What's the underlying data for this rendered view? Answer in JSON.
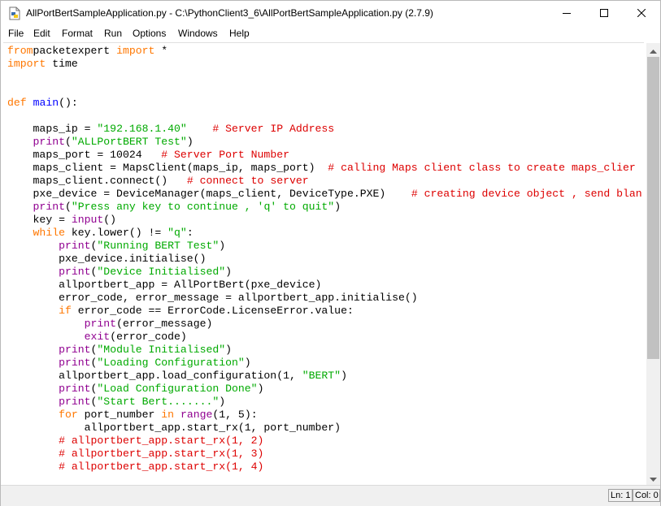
{
  "window": {
    "title": "AllPortBertSampleApplication.py - C:\\PythonClient3_6\\AllPortBertSampleApplication.py (2.7.9)",
    "icons": {
      "app": "python-file-icon",
      "minimize": "minimize-icon",
      "maximize": "maximize-icon",
      "close": "close-icon"
    }
  },
  "menu": {
    "items": [
      "File",
      "Edit",
      "Format",
      "Run",
      "Options",
      "Windows",
      "Help"
    ]
  },
  "editor": {
    "lines": [
      [
        [
          "kw",
          "from"
        ],
        [
          "",
          "packetexpert "
        ],
        [
          "kw",
          "import"
        ],
        [
          "",
          " *"
        ]
      ],
      [
        [
          "kw",
          "import"
        ],
        [
          "",
          " time"
        ]
      ],
      [],
      [],
      [
        [
          "kw",
          "def"
        ],
        [
          "",
          " "
        ],
        [
          "def",
          "main"
        ],
        [
          "",
          "():"
        ]
      ],
      [],
      [
        [
          "",
          "    maps_ip = "
        ],
        [
          "str",
          "\"192.168.1.40\""
        ],
        [
          "",
          "    "
        ],
        [
          "cmt",
          "# Server IP Address"
        ]
      ],
      [
        [
          "",
          "    "
        ],
        [
          "bi",
          "print"
        ],
        [
          "",
          "("
        ],
        [
          "str",
          "\"ALLPortBERT Test\""
        ],
        [
          "",
          ")"
        ]
      ],
      [
        [
          "",
          "    maps_port = 10024   "
        ],
        [
          "cmt",
          "# Server Port Number"
        ]
      ],
      [
        [
          "",
          "    maps_client = MapsClient(maps_ip, maps_port)  "
        ],
        [
          "cmt",
          "# calling Maps client class to create maps_clier"
        ]
      ],
      [
        [
          "",
          "    maps_client.connect()   "
        ],
        [
          "cmt",
          "# connect to server"
        ]
      ],
      [
        [
          "",
          "    pxe_device = DeviceManager(maps_client, DeviceType.PXE)    "
        ],
        [
          "cmt",
          "# creating device object , send blan"
        ]
      ],
      [
        [
          "",
          "    "
        ],
        [
          "bi",
          "print"
        ],
        [
          "",
          "("
        ],
        [
          "str",
          "\"Press any key to continue , 'q' to quit\""
        ],
        [
          "",
          ")"
        ]
      ],
      [
        [
          "",
          "    key = "
        ],
        [
          "bi",
          "input"
        ],
        [
          "",
          "()"
        ]
      ],
      [
        [
          "",
          "    "
        ],
        [
          "kw",
          "while"
        ],
        [
          "",
          " key.lower() != "
        ],
        [
          "str",
          "\"q\""
        ],
        [
          "",
          ":"
        ]
      ],
      [
        [
          "",
          "        "
        ],
        [
          "bi",
          "print"
        ],
        [
          "",
          "("
        ],
        [
          "str",
          "\"Running BERT Test\""
        ],
        [
          "",
          ")"
        ]
      ],
      [
        [
          "",
          "        pxe_device.initialise()"
        ]
      ],
      [
        [
          "",
          "        "
        ],
        [
          "bi",
          "print"
        ],
        [
          "",
          "("
        ],
        [
          "str",
          "\"Device Initialised\""
        ],
        [
          "",
          ")"
        ]
      ],
      [
        [
          "",
          "        allportbert_app = AllPortBert(pxe_device)"
        ]
      ],
      [
        [
          "",
          "        error_code, error_message = allportbert_app.initialise()"
        ]
      ],
      [
        [
          "",
          "        "
        ],
        [
          "kw",
          "if"
        ],
        [
          "",
          " error_code == ErrorCode.LicenseError.value:"
        ]
      ],
      [
        [
          "",
          "            "
        ],
        [
          "bi",
          "print"
        ],
        [
          "",
          "(error_message)"
        ]
      ],
      [
        [
          "",
          "            "
        ],
        [
          "bi",
          "exit"
        ],
        [
          "",
          "(error_code)"
        ]
      ],
      [
        [
          "",
          "        "
        ],
        [
          "bi",
          "print"
        ],
        [
          "",
          "("
        ],
        [
          "str",
          "\"Module Initialised\""
        ],
        [
          "",
          ")"
        ]
      ],
      [
        [
          "",
          "        "
        ],
        [
          "bi",
          "print"
        ],
        [
          "",
          "("
        ],
        [
          "str",
          "\"Loading Configuration\""
        ],
        [
          "",
          ")"
        ]
      ],
      [
        [
          "",
          "        allportbert_app.load_configuration(1, "
        ],
        [
          "str",
          "\"BERT\""
        ],
        [
          "",
          ")"
        ]
      ],
      [
        [
          "",
          "        "
        ],
        [
          "bi",
          "print"
        ],
        [
          "",
          "("
        ],
        [
          "str",
          "\"Load Configuration Done\""
        ],
        [
          "",
          ")"
        ]
      ],
      [
        [
          "",
          "        "
        ],
        [
          "bi",
          "print"
        ],
        [
          "",
          "("
        ],
        [
          "str",
          "\"Start Bert.......\""
        ],
        [
          "",
          ")"
        ]
      ],
      [
        [
          "",
          "        "
        ],
        [
          "kw",
          "for"
        ],
        [
          "",
          " port_number "
        ],
        [
          "kw",
          "in"
        ],
        [
          "",
          " "
        ],
        [
          "bi",
          "range"
        ],
        [
          "",
          "(1, 5):"
        ]
      ],
      [
        [
          "",
          "            allportbert_app.start_rx(1, port_number)"
        ]
      ],
      [
        [
          "",
          "        "
        ],
        [
          "cmt",
          "# allportbert_app.start_rx(1, 2)"
        ]
      ],
      [
        [
          "",
          "        "
        ],
        [
          "cmt",
          "# allportbert_app.start_rx(1, 3)"
        ]
      ],
      [
        [
          "",
          "        "
        ],
        [
          "cmt",
          "# allportbert_app.start_rx(1, 4)"
        ]
      ]
    ]
  },
  "scrollbar": {
    "up_icon": "scroll-up-arrow-icon",
    "down_icon": "scroll-down-arrow-icon"
  },
  "status": {
    "line": "Ln: 1",
    "col": "Col: 0"
  }
}
